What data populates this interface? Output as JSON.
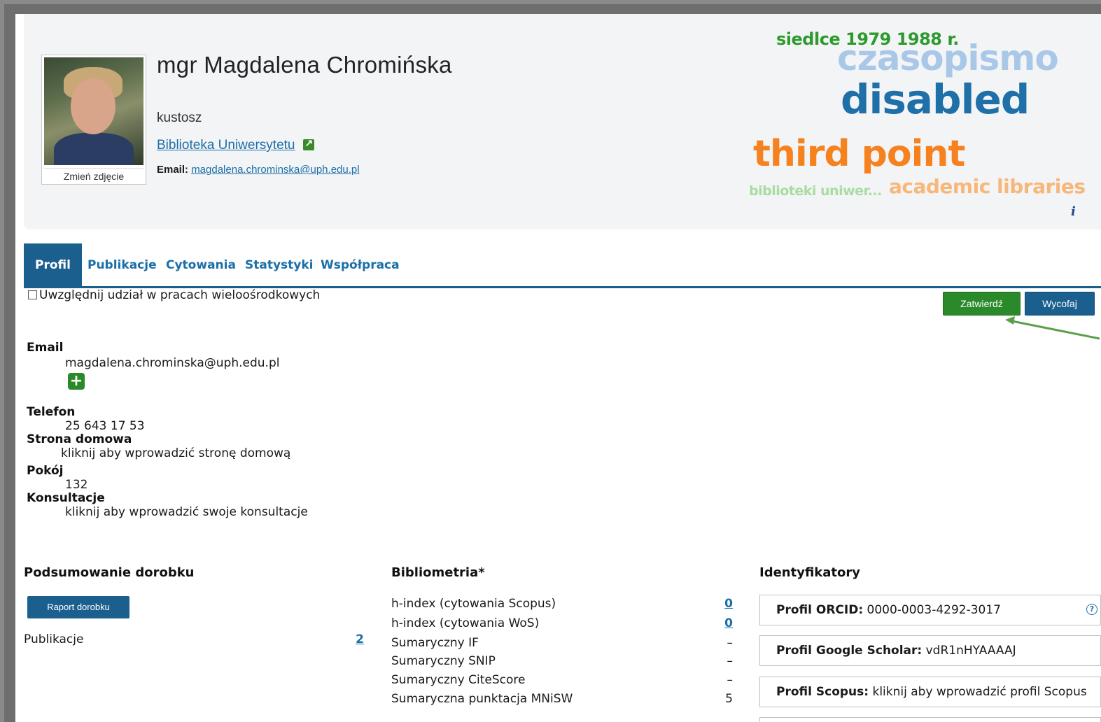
{
  "profile": {
    "name": "mgr Magdalena Chromińska",
    "role": "kustosz",
    "unit": "Biblioteka Uniwersytetu",
    "email_label": "Email:",
    "email": "magdalena.chrominska@uph.edu.pl",
    "photo_caption": "Zmień zdjęcie"
  },
  "word_cloud": [
    {
      "text": "siedlce 1979 1988 r.",
      "color": "#2e9a2e"
    },
    {
      "text": "czasopismo",
      "color": "#a9c8e8"
    },
    {
      "text": "disabled",
      "color": "#1f6fa8"
    },
    {
      "text": "third point",
      "color": "#f5821f"
    },
    {
      "text": "biblioteki uniwer...",
      "color": "#a8dca0"
    },
    {
      "text": "academic libraries",
      "color": "#f7b77a"
    }
  ],
  "tabs": [
    "Profil",
    "Publikacje",
    "Cytowania",
    "Statystyki",
    "Współpraca"
  ],
  "controls": {
    "multicenter_label": "Uwzględnij udział w pracach wieloośrodkowych",
    "confirm": "Zatwierdź",
    "cancel": "Wycofaj"
  },
  "fields": {
    "email_label": "Email",
    "email_value": "magdalena.chrominska@uph.edu.pl",
    "phone_label": "Telefon",
    "phone_value": "25 643 17 53",
    "homepage_label": "Strona domowa",
    "homepage_value": "kliknij aby wprowadzić stronę domową",
    "room_label": "Pokój",
    "room_value": "132",
    "consult_label": "Konsultacje",
    "consult_value": "kliknij aby wprowadzić swoje konsultacje"
  },
  "summary": {
    "title": "Podsumowanie dorobku",
    "report_button": "Raport dorobku",
    "publications_label": "Publikacje",
    "publications_value": "2"
  },
  "bibliometrics": {
    "title": "Bibliometria*",
    "rows": [
      {
        "label": "h-index (cytowania Scopus)",
        "value": "0"
      },
      {
        "label": "h-index (cytowania WoS)",
        "value": "0"
      },
      {
        "label": "Sumaryczny IF",
        "value": "–"
      },
      {
        "label": "Sumaryczny SNIP",
        "value": "–"
      },
      {
        "label": "Sumaryczny CiteScore",
        "value": "–"
      },
      {
        "label": "Sumaryczna punktacja MNiSW",
        "value": "5"
      }
    ]
  },
  "identifiers": {
    "title": "Identyfikatory",
    "orcid_label": "Profil ORCID:",
    "orcid_value": "0000-0003-4292-3017",
    "scholar_label": "Profil Google Scholar:",
    "scholar_value": "vdR1nHYAAAAJ",
    "scopus_label": "Profil Scopus:",
    "scopus_value": "kliknij aby wprowadzić profil Scopus"
  },
  "colors": {
    "accent": "#1b5f8f",
    "link": "#1b6fa8",
    "confirm": "#2a8a2a",
    "header_bg": "#f3f4f6"
  }
}
